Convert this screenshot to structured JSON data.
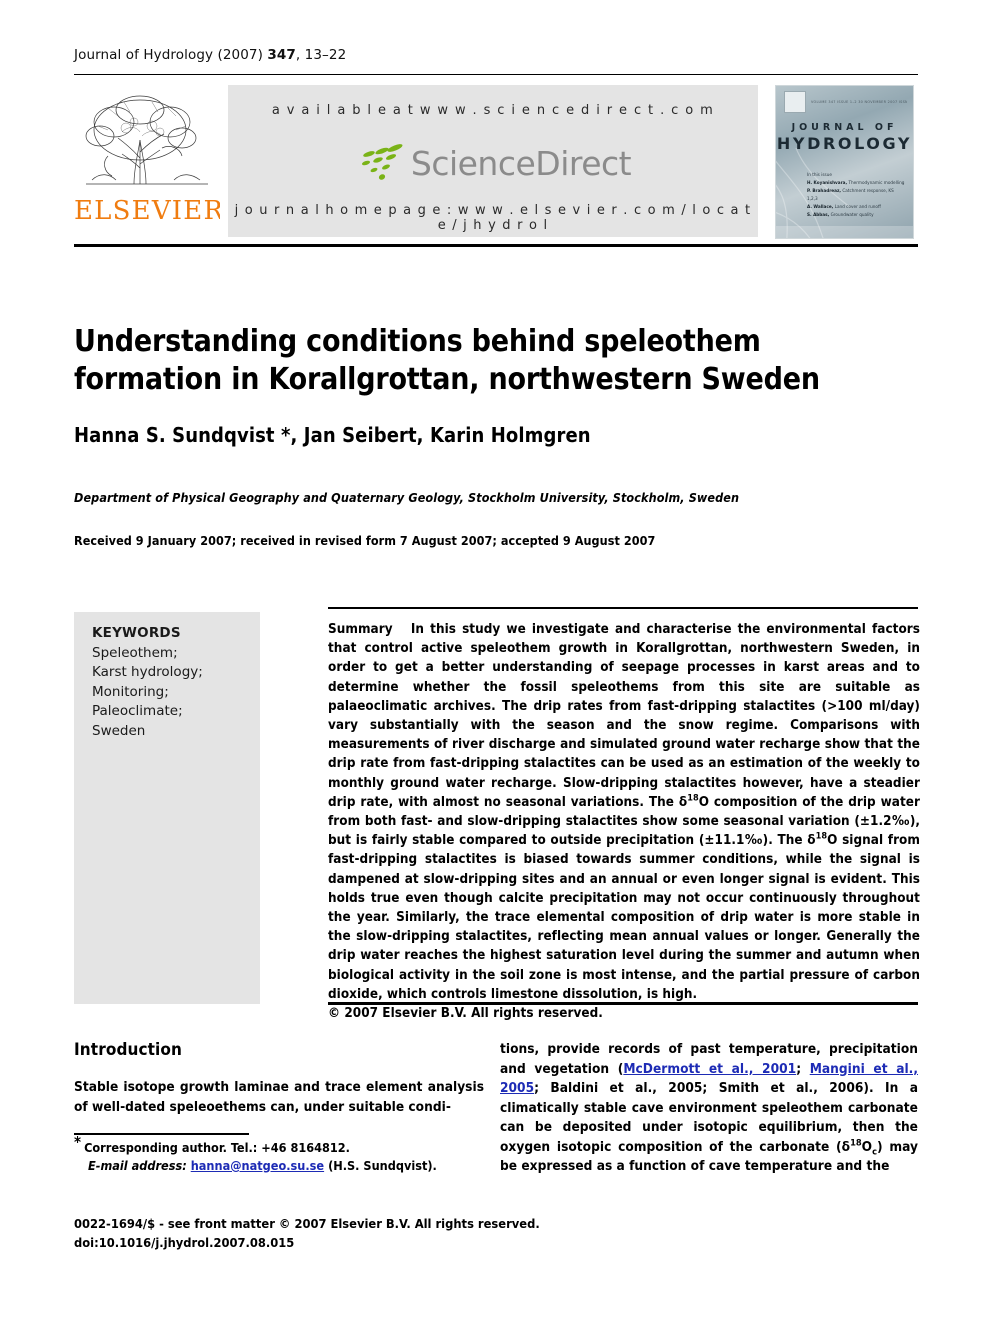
{
  "running_head": {
    "journal": "Journal of Hydrology",
    "year": "(2007)",
    "volume": "347",
    "pages": ", 13–22"
  },
  "masthead": {
    "elsevier_wordmark": "ELSEVIER",
    "elsevier_color": "#F07C10",
    "available_at": "a v a i l a b l e   a t   w w w . s c i e n c e d i r e c t . c o m",
    "sciencedirect_wordmark": "ScienceDirect",
    "journal_homepage": "j o u r n a l   h o m e p a g e :   w w w . e l s e v i e r . c o m / l o c a t e / j h y d r o l",
    "band_color": "#e4e4e4",
    "cover": {
      "top_line": "VOLUME 347  ISSUE 1–2  30 NOVEMBER 2007                 ISSN 0022-1694",
      "title_line1": "JOURNAL OF",
      "title_line2": "HYDROLOGY",
      "toc_heading": "In this issue",
      "toc_items": [
        {
          "authors": "H. Koyanishvara,",
          "rest": "Thermodynamic modelling"
        },
        {
          "authors": "P. Brahadreaz,",
          "rest": "Catchment response, KS 1,2,3"
        },
        {
          "authors": "A. Wallace,",
          "rest": "Land cover and runoff"
        },
        {
          "authors": "S. Abbas,",
          "rest": "Groundwater quality"
        }
      ]
    }
  },
  "article": {
    "title": "Understanding conditions behind speleothem formation in Korallgrottan, northwestern Sweden",
    "authors": "Hanna S. Sundqvist *, Jan Seibert, Karin Holmgren",
    "affiliation": "Department of Physical Geography and Quaternary Geology, Stockholm University, Stockholm, Sweden",
    "history": "Received 9 January 2007; received in revised form 7 August 2007; accepted 9 August 2007"
  },
  "keywords": {
    "heading": "KEYWORDS",
    "items": [
      "Speleothem;",
      "Karst hydrology;",
      "Monitoring;",
      "Paleoclimate;",
      "Sweden"
    ]
  },
  "abstract": {
    "label": "Summary",
    "paragraph_parts": {
      "p1": "In this study we investigate and characterise the environmental factors that control active speleothem growth in Korallgrottan, northwestern Sweden, in order to get a better understanding of seepage processes in karst areas and to determine whether the fossil speleothems from this site are suitable as palaeoclimatic archives. The drip rates from fast-dripping stalactites (>100 ml/day) vary substantially with the season and the snow regime. Comparisons with measurements of river discharge and simulated ground water recharge show that the drip rate from fast-dripping stalactites can be used as an estimation of the weekly to monthly ground water recharge. Slow-dripping stalactites however, have a steadier drip rate, with almost no seasonal variations. The ",
      "delta1_delta": "δ",
      "delta1_sup": "18",
      "delta1_o": "O",
      "p2": " composition of the drip water from both fast- and slow-dripping stalactites show some seasonal variation (±1.2‰), but is fairly stable compared to outside precipitation (±11.1‰). The ",
      "delta2_delta": "δ",
      "delta2_sup": "18",
      "delta2_o": "O",
      "p3": " signal from fast-dripping stalactites is biased towards summer conditions, while the signal is dampened at slow-dripping sites and an annual or even longer signal is evident. This holds true even though calcite precipitation may not occur continuously throughout the year. Similarly, the trace elemental composition of drip water is more stable in the slow-dripping stalactites, reflecting mean annual values or longer. Generally the drip water reaches the highest saturation level during the summer and autumn when biological activity in the soil zone is most intense, and the partial pressure of carbon dioxide, which controls limestone dissolution, is high."
    },
    "copyright": "© 2007 Elsevier B.V. All rights reserved."
  },
  "introduction": {
    "heading": "Introduction",
    "left_text": "Stable isotope growth laminae and trace element analysis of well-dated speleoethems can, under suitable condi-",
    "right_parts": {
      "r1": "tions, provide records of past temperature, precipitation and vegetation (",
      "cite1": "McDermott et al., 2001",
      "sep1": "; ",
      "cite2": "Mangini et al., 2005",
      "r2": "; Baldini et al., 2005; Smith et al., 2006). In a climatically stable cave environment speleothem carbonate can be deposited under isotopic equilibrium, then the oxygen isotopic composition of the carbonate (",
      "delta_d": "δ",
      "delta_sup": "18",
      "delta_o": "O",
      "delta_sub": "c",
      "r3": ") may be expressed as a function of cave temperature and the"
    }
  },
  "footnote": {
    "corresponding": "Corresponding author. Tel.: +46 8164812.",
    "email_label": "E-mail address:",
    "email": "hanna@natgeo.su.se",
    "email_owner": "(H.S. Sundqvist).",
    "link_color": "#1d2bb5"
  },
  "footer": {
    "front_matter": "0022-1694/$ - see front matter © 2007 Elsevier B.V. All rights reserved.",
    "doi": "doi:10.1016/j.jhydrol.2007.08.015"
  }
}
